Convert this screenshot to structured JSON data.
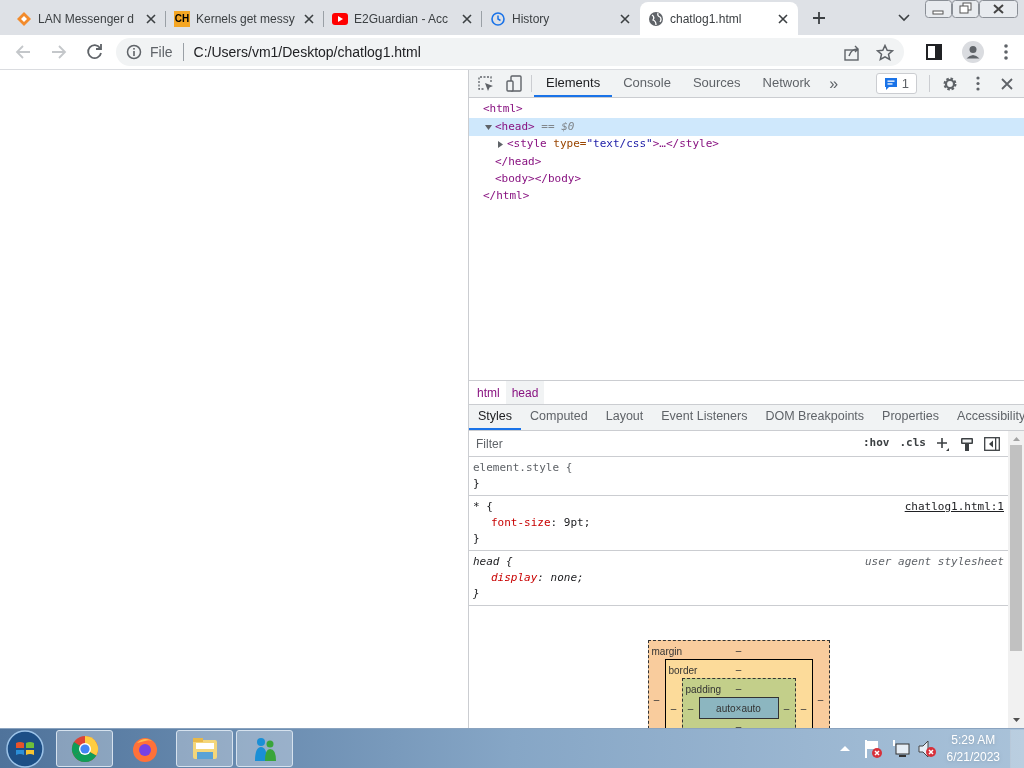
{
  "browser_tabs": [
    {
      "title": "LAN Messenger d",
      "kind": "diamond",
      "selected": false
    },
    {
      "title": "Kernels get messy",
      "kind": "letters",
      "icon_text": "CH",
      "selected": false
    },
    {
      "title": "E2Guardian - Acc",
      "kind": "video",
      "selected": false
    },
    {
      "title": "History",
      "kind": "history",
      "selected": false
    },
    {
      "title": "chatlog1.html",
      "kind": "globe",
      "selected": true
    }
  ],
  "address_bar": {
    "scheme_label": "File",
    "url": "C:/Users/vm1/Desktop/chatlog1.html",
    "back_disabled": true,
    "forward_disabled": true
  },
  "devtools": {
    "panel_tabs": [
      {
        "label": "Elements",
        "selected": true
      },
      {
        "label": "Console",
        "selected": false
      },
      {
        "label": "Sources",
        "selected": false
      },
      {
        "label": "Network",
        "selected": false
      }
    ],
    "more_tabs": "»",
    "issues_count": "1",
    "dom_tree": [
      {
        "open": "<html>",
        "close": "</html>",
        "children": [
          {
            "open": "<head>",
            "note": "== $0",
            "selected": true,
            "expanded": true,
            "close": "</head>",
            "children": [
              {
                "open": "<style type=\"text/css\">…</style>",
                "expanded": false
              }
            ]
          },
          {
            "open": "<body></body>"
          }
        ]
      }
    ],
    "breadcrumbs": [
      {
        "label": "html",
        "selected": false
      },
      {
        "label": "head",
        "selected": true
      }
    ],
    "sidebar_tabs": [
      {
        "label": "Styles",
        "selected": true
      },
      {
        "label": "Computed",
        "selected": false
      },
      {
        "label": "Layout",
        "selected": false
      },
      {
        "label": "Event Listeners",
        "selected": false
      },
      {
        "label": "DOM Breakpoints",
        "selected": false
      },
      {
        "label": "Properties",
        "selected": false
      },
      {
        "label": "Accessibility",
        "selected": false
      }
    ],
    "filter": {
      "placeholder": "Filter",
      "hov": ":hov",
      "cls": ".cls"
    },
    "rules": [
      {
        "kind": "inline",
        "selector": "element.style {",
        "close": "}"
      },
      {
        "kind": "author",
        "selector": "* {",
        "source": "chatlog1.html:1",
        "close": "}",
        "declarations": [
          {
            "property": "font-size",
            "colon": ":",
            "value": "9pt;"
          }
        ]
      },
      {
        "kind": "user_agent",
        "selector": "head {",
        "source": "user agent stylesheet",
        "close": "}",
        "declarations": [
          {
            "property": "display",
            "colon": ":",
            "value": "none;"
          }
        ]
      }
    ],
    "box_model": {
      "margin": {
        "label": "margin",
        "top": "–",
        "left": "–",
        "right": "–"
      },
      "border": {
        "label": "border",
        "top": "–",
        "left": "–",
        "right": "–"
      },
      "padding": {
        "label": "padding",
        "top": "–",
        "left": "–",
        "right": "–",
        "bottom": "–"
      },
      "content": "auto×auto"
    }
  },
  "taskbar": {
    "apps": [
      {
        "kind": "chrome",
        "active": true
      },
      {
        "kind": "firefox",
        "active": false
      },
      {
        "kind": "folder",
        "active": true
      },
      {
        "kind": "messenger",
        "active": true
      }
    ],
    "time": "5:29 AM",
    "date": "6/21/2023"
  }
}
